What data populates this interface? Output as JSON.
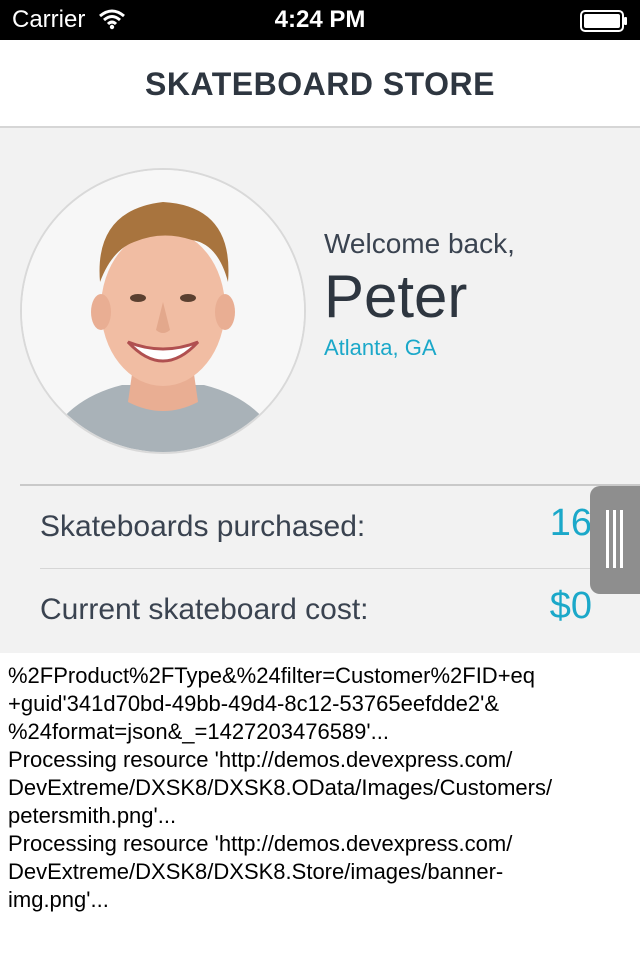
{
  "status_bar": {
    "carrier": "Carrier",
    "time": "4:24 PM",
    "wifi_icon": "wifi-icon",
    "battery_icon": "battery-icon"
  },
  "header": {
    "title": "SKATEBOARD STORE"
  },
  "profile": {
    "avatar_icon": "avatar",
    "welcome": "Welcome back,",
    "name": "Peter",
    "location": "Atlanta, GA"
  },
  "stats": [
    {
      "label": "Skateboards purchased:",
      "value": "16"
    },
    {
      "label": "Current skateboard cost:",
      "value": "$0"
    }
  ],
  "log": {
    "lines": [
      "%2FProduct%2FType&%24filter=Customer%2FID+eq",
      "+guid'341d70bd-49bb-49d4-8c12-53765eefdde2'&",
      "%24format=json&_=1427203476589'...",
      "Processing resource 'http://demos.devexpress.com/",
      "DevExtreme/DXSK8/DXSK8.OData/Images/Customers/",
      "petersmith.png'...",
      "Processing resource 'http://demos.devexpress.com/",
      "DevExtreme/DXSK8/DXSK8.Store/images/banner-",
      "img.png'..."
    ]
  },
  "colors": {
    "accent": "#1ba8c9",
    "title_text": "#2e3640",
    "panel_bg": "#f2f2f2"
  }
}
